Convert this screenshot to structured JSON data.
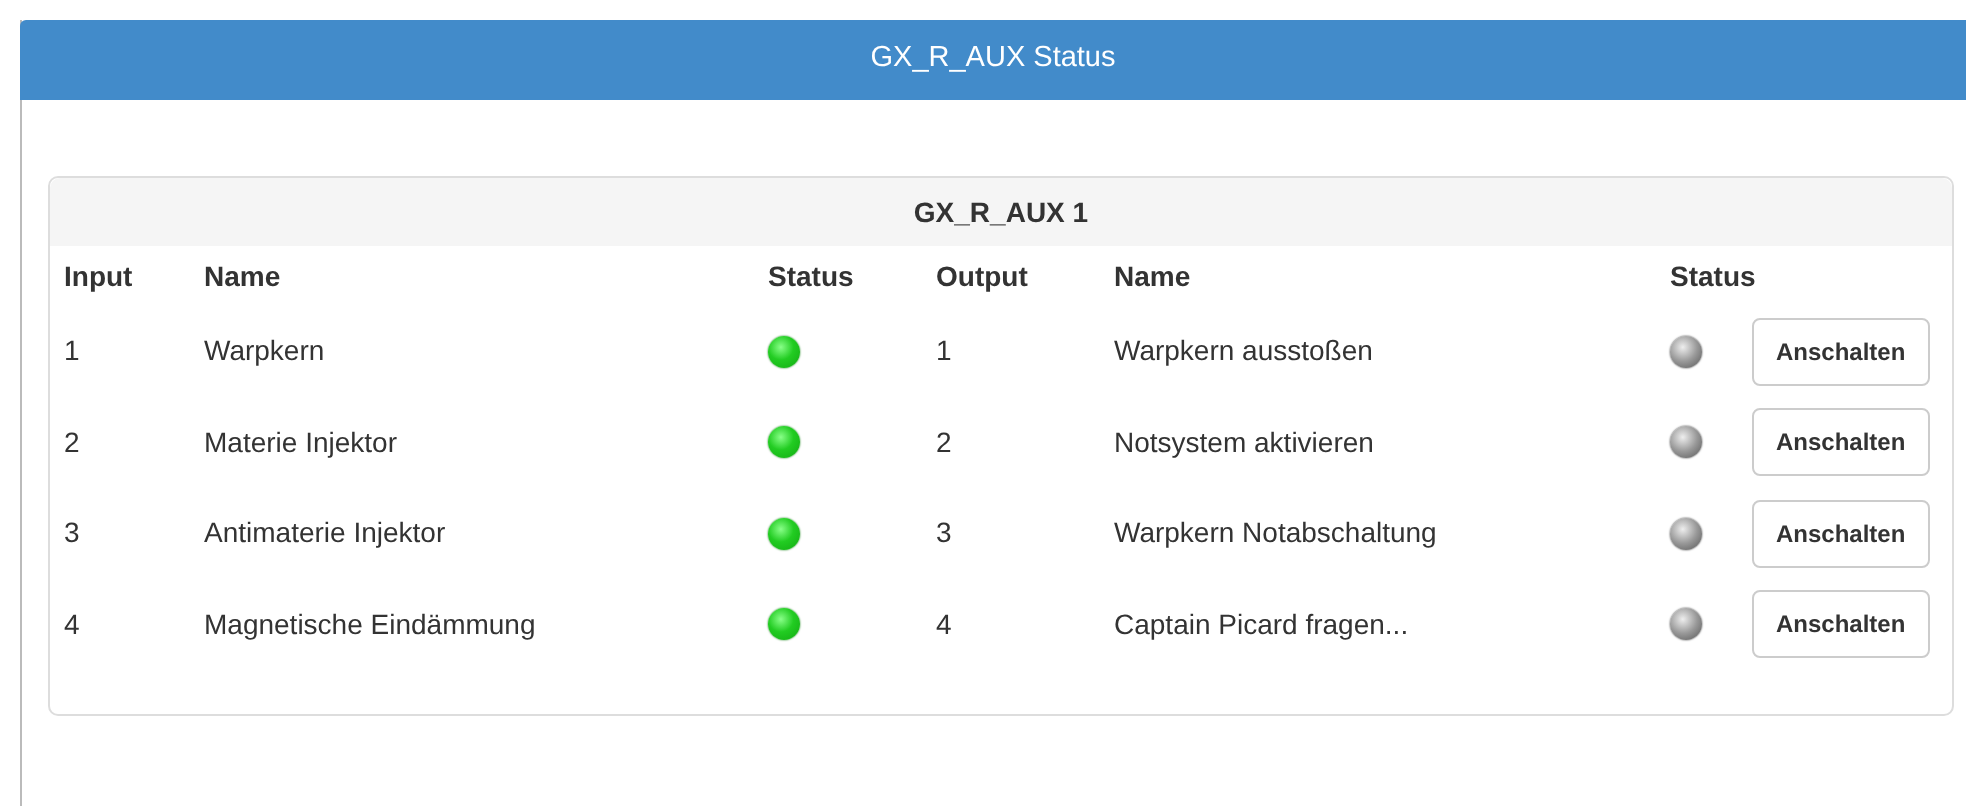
{
  "window": {
    "title": "GX_R_AUX Status"
  },
  "panel": {
    "title": "GX_R_AUX 1",
    "columns": [
      "Input",
      "Name",
      "Status",
      "Output",
      "Name",
      "Status"
    ],
    "rows": [
      {
        "input": "1",
        "input_name": "Warpkern",
        "input_on": true,
        "output": "1",
        "output_name": "Warpkern ausstoßen",
        "output_on": false,
        "button": "Anschalten"
      },
      {
        "input": "2",
        "input_name": "Materie Injektor",
        "input_on": true,
        "output": "2",
        "output_name": "Notsystem aktivieren",
        "output_on": false,
        "button": "Anschalten"
      },
      {
        "input": "3",
        "input_name": "Antimaterie Injektor",
        "input_on": true,
        "output": "3",
        "output_name": "Warpkern Notabschaltung",
        "output_on": false,
        "button": "Anschalten"
      },
      {
        "input": "4",
        "input_name": "Magnetische Eindämmung",
        "input_on": true,
        "output": "4",
        "output_name": "Captain Picard fragen...",
        "output_on": false,
        "button": "Anschalten"
      }
    ]
  }
}
